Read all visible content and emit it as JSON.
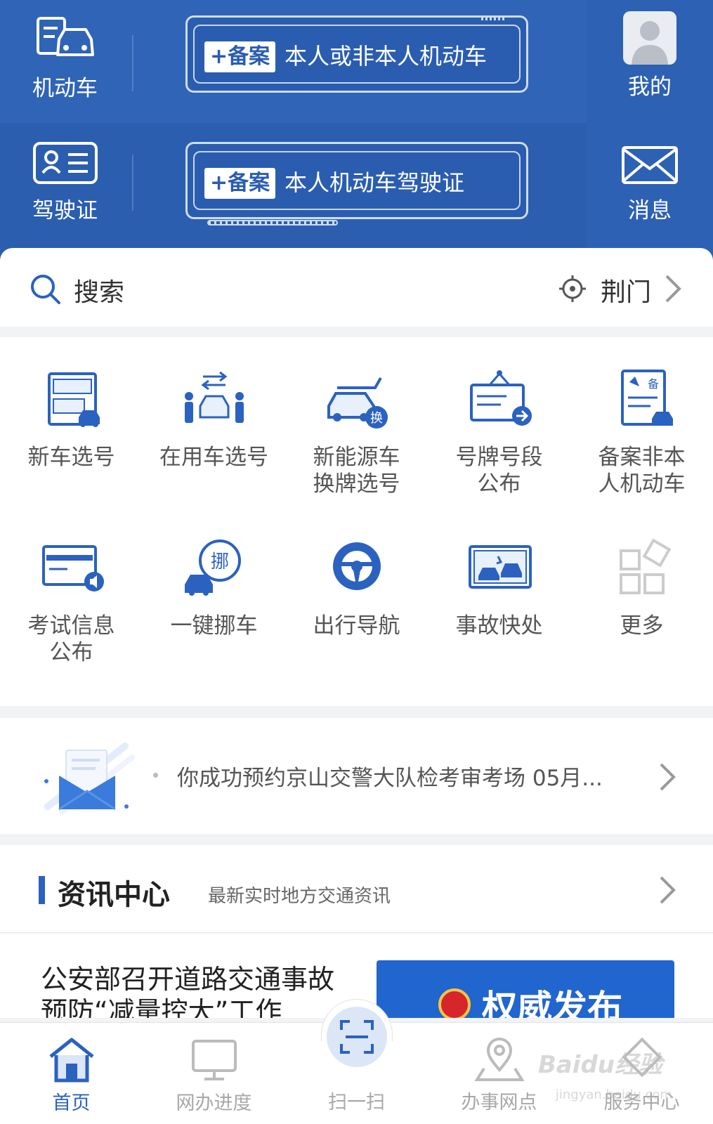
{
  "header": {
    "left": [
      {
        "label": "机动车",
        "icon": "vehicle-icon"
      },
      {
        "label": "驾驶证",
        "icon": "license-icon"
      }
    ],
    "cards": [
      {
        "tag": "+备案",
        "text": "本人或非本人机动车"
      },
      {
        "tag": "+备案",
        "text": "本人机动车驾驶证"
      }
    ],
    "right": [
      {
        "label": "我的",
        "icon": "avatar-icon"
      },
      {
        "label": "消息",
        "icon": "mail-icon"
      }
    ]
  },
  "search": {
    "placeholder": "搜索",
    "location": "荆门"
  },
  "services": [
    {
      "label": "新车选号",
      "icon": "new-car-plate-icon"
    },
    {
      "label": "在用车选号",
      "icon": "used-car-plate-icon"
    },
    {
      "label": "新能源车换牌选号",
      "icon": "ev-plate-icon"
    },
    {
      "label": "号牌号段公布",
      "icon": "plate-range-icon"
    },
    {
      "label": "备案非本人机动车",
      "icon": "register-other-vehicle-icon"
    },
    {
      "label": "考试信息公布",
      "icon": "exam-info-icon"
    },
    {
      "label": "一键挪车",
      "icon": "move-car-icon"
    },
    {
      "label": "出行导航",
      "icon": "navigation-icon"
    },
    {
      "label": "事故快处",
      "icon": "accident-icon"
    },
    {
      "label": "更多",
      "icon": "more-icon"
    }
  ],
  "notice": {
    "text": "你成功预约京山交警大队检考审考场 05月..."
  },
  "news": {
    "title": "资讯中心",
    "subtitle": "最新实时地方交通资讯",
    "item_title": "公安部召开道路交通事故预防“减量控大”工作",
    "thumb_text": "权威发布"
  },
  "tabs": [
    {
      "label": "首页",
      "active": true
    },
    {
      "label": "网办进度",
      "active": false
    },
    {
      "label": "扫一扫",
      "active": false
    },
    {
      "label": "办事网点",
      "active": false
    },
    {
      "label": "服务中心",
      "active": false
    }
  ],
  "watermark": {
    "main": "Baidu经验",
    "sub": "jingyan.baidu.com"
  },
  "colors": {
    "brand": "#2f64b7",
    "accent": "#2b62c0"
  }
}
